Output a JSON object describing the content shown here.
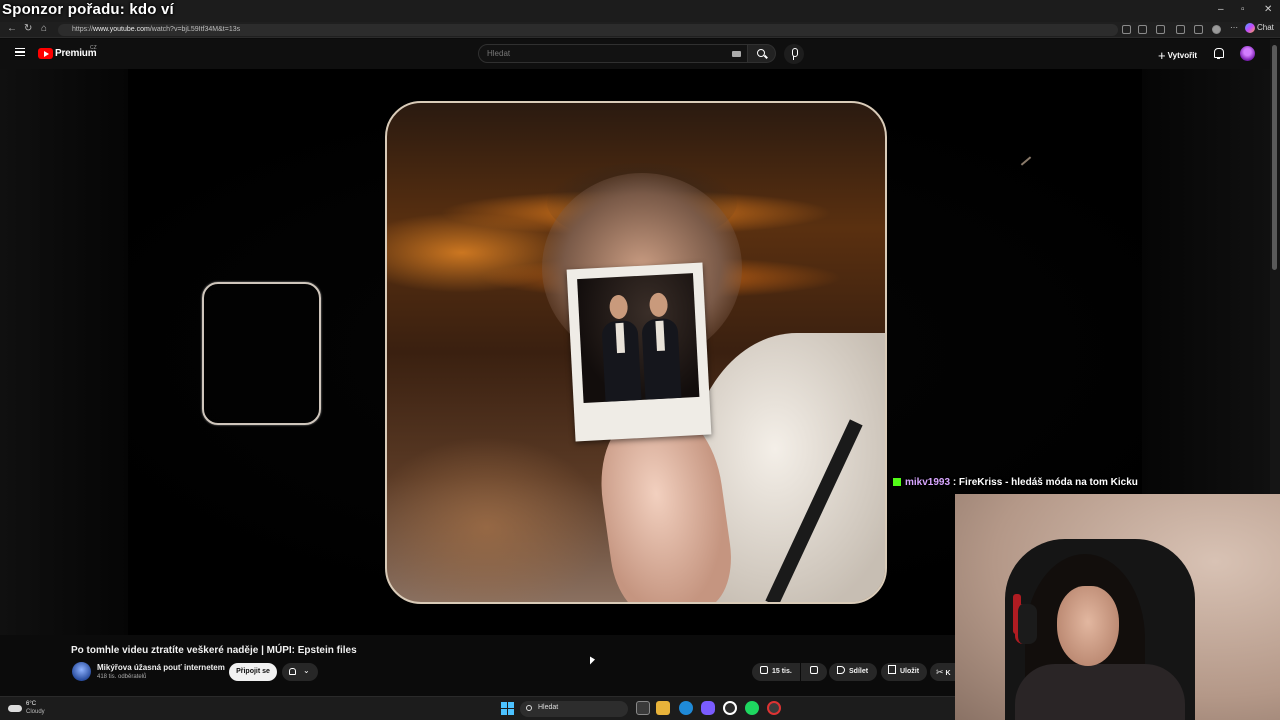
{
  "overlay": {
    "sponsor_text": "Sponzor pořadu: kdo ví"
  },
  "browser": {
    "url_prefix": "https://",
    "url_host": "www.youtube.com",
    "url_path": "/watch?v=bjL59Itf34M&t=13s",
    "chat_label": "Chat",
    "window_controls": [
      "–",
      "▫",
      "✕"
    ]
  },
  "youtube": {
    "logo_label": "Premium",
    "region": "CZ",
    "search_placeholder": "Hledat",
    "create_label": "Vytvořit"
  },
  "video": {
    "title": "Po tomhle videu ztratíte veškeré naděje | MÚPI: Epstein files",
    "channel": "Mikýřova úžasná pouť internetem",
    "subscribers": "418 tis. odběratelů",
    "join_label": "Připojit se",
    "likes": "15 tis.",
    "share_label": "Sdílet",
    "save_label": "Uložit",
    "clip_label": "K"
  },
  "chat": {
    "user": "mikv1993",
    "message": " : FireKriss - hledáš móda na tom Kicku"
  },
  "taskbar": {
    "temperature": "6°C",
    "condition": "Cloudy",
    "search_label": "Hledat"
  },
  "colors": {
    "youtube_red": "#ff0000",
    "kick_green": "#53fc18",
    "chat_user": "#d8a6ff"
  }
}
